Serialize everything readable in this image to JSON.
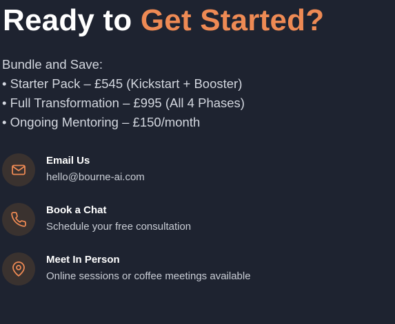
{
  "headline": {
    "prefix": "Ready to",
    "accent": "Get Started?"
  },
  "bundle": {
    "heading": "Bundle and Save:",
    "items": [
      "• Starter Pack – £545 (Kickstart + Booster)",
      "• Full Transformation – £995 (All 4 Phases)",
      "• Ongoing Mentoring – £150/month"
    ]
  },
  "contacts": [
    {
      "icon": "mail-icon",
      "title": "Email Us",
      "subtitle": "hello@bourne-ai.com"
    },
    {
      "icon": "phone-icon",
      "title": "Book a Chat",
      "subtitle": "Schedule your free consultation"
    },
    {
      "icon": "map-pin-icon",
      "title": "Meet In Person",
      "subtitle": "Online sessions or coffee meetings available"
    }
  ],
  "colors": {
    "background": "#1e2330",
    "accent": "#ee8a54",
    "icon_circle": "#3a322f",
    "text_primary": "#ffffff",
    "text_secondary": "#c9cdd5"
  }
}
